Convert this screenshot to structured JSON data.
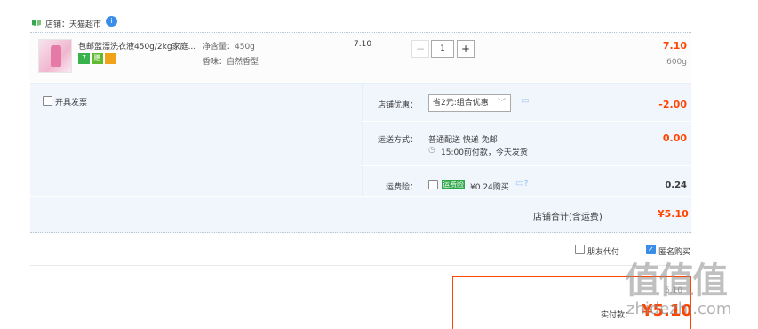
{
  "shop": {
    "label": "店铺：天猫超市",
    "ww_icon": "i"
  },
  "item": {
    "title": "包邮蓝漂洗衣液450g/2kg家庭...",
    "badges": [
      "7",
      "赠",
      ""
    ],
    "sku_weight": "净含量：450g",
    "sku_scent": "香味：自然香型",
    "unit_price": "7.10",
    "qty_minus": "−",
    "qty": "1",
    "qty_plus": "+",
    "total": "7.10",
    "weight": "600g"
  },
  "options": {
    "invoice_label": "开具发票",
    "discount_label": "店铺优惠：",
    "discount_select": "省2元:组合优惠",
    "discount_value": "-2.00",
    "shipping_label": "运送方式：",
    "shipping_method": "普通配送 快递 免邮",
    "shipping_note": "15:00前付款，今天发货",
    "shipping_value": "0.00",
    "insurance_label": "运费险：",
    "insurance_tag": "运费险",
    "insurance_text": "¥0.24购买",
    "insurance_value": "0.24"
  },
  "subtotal": {
    "label": "店铺合计(含运费)",
    "value": "¥5.10"
  },
  "checkout_opts": {
    "friend_pay": "朋友代付",
    "anonymous": "匿名购买"
  },
  "pay": {
    "partial_top": "5.10",
    "label": "实付款：",
    "value": "¥5.10"
  },
  "watermark": {
    "main": "值值值",
    "sub": "zhidezhi.com"
  },
  "colors": {
    "accent": "#ff4400",
    "blue": "#3b8ee7",
    "panel": "#f1f6fd"
  }
}
